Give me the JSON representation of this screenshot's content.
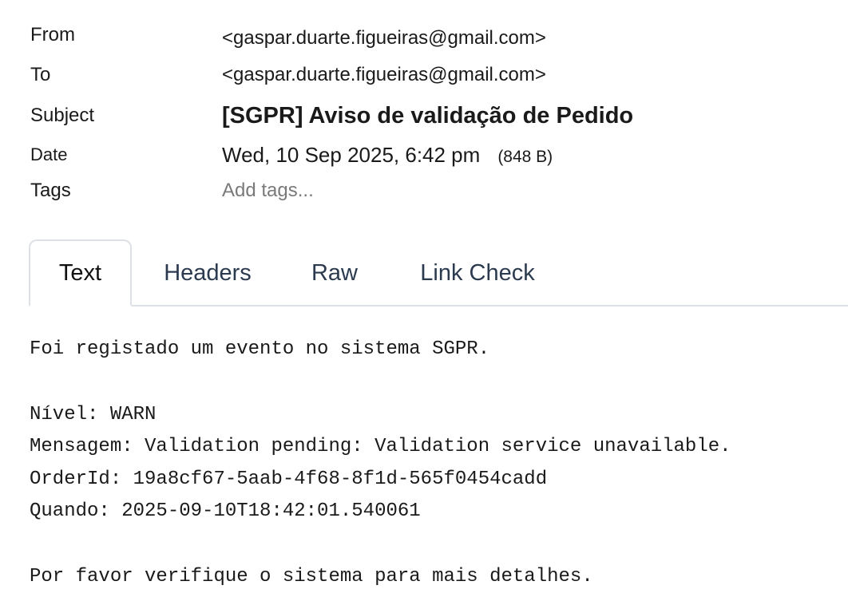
{
  "headers": {
    "from_label": "From",
    "from_value": "<gaspar.duarte.figueiras@gmail.com>",
    "to_label": "To",
    "to_value": "<gaspar.duarte.figueiras@gmail.com>",
    "subject_label": "Subject",
    "subject_value": "[SGPR] Aviso de validação de Pedido",
    "date_label": "Date",
    "date_value": "Wed, 10 Sep 2025, 6:42 pm",
    "size_value": "(848 B)",
    "tags_label": "Tags",
    "tags_placeholder": "Add tags..."
  },
  "tabs": [
    {
      "label": "Text",
      "active": true
    },
    {
      "label": "Headers",
      "active": false
    },
    {
      "label": "Raw",
      "active": false
    },
    {
      "label": "Link Check",
      "active": false
    }
  ],
  "body": {
    "line1": "Foi registado um evento no sistema SGPR.",
    "line2": "",
    "line3": "Nível: WARN",
    "line4": "Mensagem: Validation pending: Validation service unavailable.",
    "line5": "OrderId: 19a8cf67-5aab-4f68-8f1d-565f0454cadd",
    "line6": "Quando: 2025-09-10T18:42:01.540061",
    "line7": "",
    "line8": "Por favor verifique o sistema para mais detalhes."
  },
  "colors": {
    "tab_text": "#2b3a4e",
    "tab_border": "#dde1e6",
    "placeholder": "#7a7a7a"
  }
}
